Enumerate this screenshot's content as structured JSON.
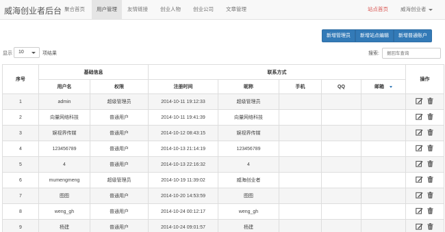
{
  "navbar": {
    "brand": "威海创业者后台",
    "items": [
      "聚合首页",
      "用户管理",
      "友情链接",
      "创业人物",
      "创业公司",
      "文章管理"
    ],
    "active_index": 1,
    "site_home": "站点首页",
    "user": "威海创业者"
  },
  "toolbar": {
    "buttons": [
      "新增管理员",
      "新增站点编辑",
      "新增普通账户"
    ]
  },
  "controls": {
    "show_label": "显示",
    "page_size": "10",
    "items_suffix": "项结果",
    "search_label": "搜索:",
    "search_placeholder": "据回车查询"
  },
  "table": {
    "group_headers": {
      "index": "序号",
      "basic": "基础信息",
      "contact": "联系方式",
      "ops": "操作"
    },
    "columns": [
      "用户名",
      "权限",
      "注册时间",
      "昵称",
      "手机",
      "QQ",
      "邮箱"
    ],
    "rows": [
      {
        "index": "1",
        "username": "admin",
        "role": "超级管理员",
        "registered": "2014-10-11 19:12:33",
        "nickname": "超级管理员",
        "phone": "",
        "qq": "",
        "email": ""
      },
      {
        "index": "2",
        "username": "向量网络科技",
        "role": "普通用户",
        "registered": "2014-10-11 19:41:39",
        "nickname": "向量网络科技",
        "phone": "",
        "qq": "",
        "email": ""
      },
      {
        "index": "3",
        "username": "娱视界传媒",
        "role": "普通用户",
        "registered": "2014-10-12 08:43:15",
        "nickname": "娱视界传媒",
        "phone": "",
        "qq": "",
        "email": ""
      },
      {
        "index": "4",
        "username": "123456789",
        "role": "普通用户",
        "registered": "2014-10-13 21:14:19",
        "nickname": "123456789",
        "phone": "",
        "qq": "",
        "email": ""
      },
      {
        "index": "5",
        "username": "4",
        "role": "普通用户",
        "registered": "2014-10-13 22:16:32",
        "nickname": "4",
        "phone": "",
        "qq": "",
        "email": ""
      },
      {
        "index": "6",
        "username": "mumengmeng",
        "role": "超级管理员",
        "registered": "2014-10-19 11:39:02",
        "nickname": "威海创业者",
        "phone": "",
        "qq": "",
        "email": ""
      },
      {
        "index": "7",
        "username": "图图",
        "role": "普通用户",
        "registered": "2014-10-20 14:53:59",
        "nickname": "图图",
        "phone": "",
        "qq": "",
        "email": ""
      },
      {
        "index": "8",
        "username": "weng_gh",
        "role": "普通用户",
        "registered": "2014-10-24 00:12:17",
        "nickname": "weng_gh",
        "phone": "",
        "qq": "",
        "email": ""
      },
      {
        "index": "9",
        "username": "杨建",
        "role": "普通用户",
        "registered": "2014-10-24 09:01:57",
        "nickname": "杨建",
        "phone": "",
        "qq": "",
        "email": ""
      }
    ]
  },
  "icons": {
    "edit": "edit-icon",
    "delete": "trash-icon",
    "sort": "sort-desc-icon"
  },
  "colors": {
    "primary": "#337ab7",
    "site_home": "#d9534f",
    "stripe": "#f5f5f5"
  }
}
